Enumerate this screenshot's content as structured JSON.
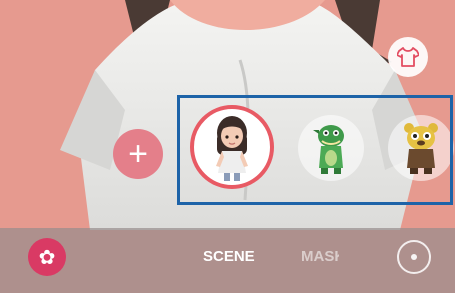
{
  "colors": {
    "background": "#e69a8f",
    "selection_ring": "#e85a64",
    "highlight_box": "#1d63a8",
    "effects_button": "#d93a64",
    "add_button": "#e47f8a"
  },
  "top": {
    "outfit_icon": "tshirt-icon"
  },
  "carousel": {
    "add_icon": "plus-icon",
    "add_symbol": "+",
    "items": [
      {
        "icon": "girl-avatar-emoji",
        "selected": true
      },
      {
        "icon": "dinosaur-avatar-emoji",
        "selected": false
      },
      {
        "icon": "bear-avatar-emoji",
        "selected": false
      }
    ]
  },
  "bottom_bar": {
    "effects_icon": "flower-icon",
    "effects_symbol": "✿",
    "modes": [
      "SCENE",
      "MASK"
    ],
    "active_mode": "SCENE",
    "switch_icon": "switch-camera-icon"
  }
}
